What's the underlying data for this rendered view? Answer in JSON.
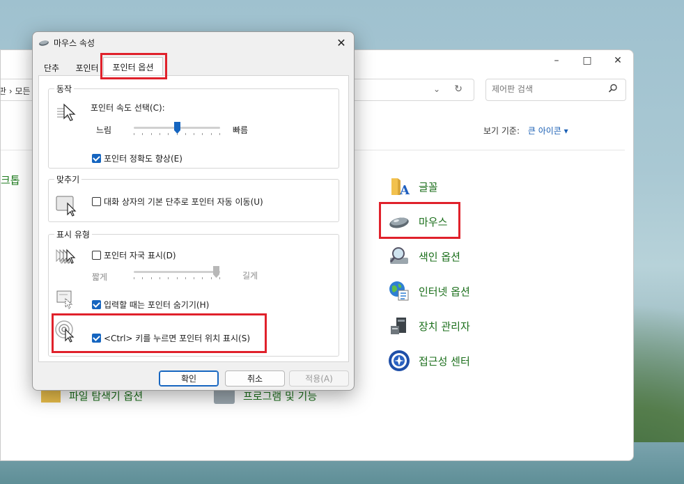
{
  "control_panel": {
    "breadcrumb": "판 › 모든",
    "search_placeholder": "제어판 검색",
    "view_by_label": "보기 기준:",
    "view_by_value": "큰 아이콘 ▾",
    "partial_left_item": "크톱",
    "items": [
      {
        "label": "글꼴",
        "icon": "font-icon"
      },
      {
        "label": "마우스",
        "icon": "mouse-icon"
      },
      {
        "label": "색인 옵션",
        "icon": "indexing-icon"
      },
      {
        "label": "인터넷 옵션",
        "icon": "internet-options-icon"
      },
      {
        "label": "장치 관리자",
        "icon": "device-manager-icon"
      },
      {
        "label": "접근성 센터",
        "icon": "ease-of-access-icon"
      }
    ],
    "bottom_items": [
      "파일 탐색기 옵션",
      "프로그램 및 기능"
    ]
  },
  "dialog": {
    "title": "마우스 속성",
    "tabs": [
      "단추",
      "포인터",
      "포인터 옵션"
    ],
    "active_tab": "포인터 옵션",
    "motion": {
      "group_title": "동작",
      "speed_label": "포인터 속도 선택(C):",
      "slow": "느림",
      "fast": "빠름",
      "speed_value": 0.5,
      "precision_label": "포인터 정확도 향상(E)",
      "precision_checked": true
    },
    "snap": {
      "group_title": "맞추기",
      "snap_label": "대화 상자의 기본 단추로 포인터 자동 이동(U)",
      "snap_checked": false
    },
    "visibility": {
      "group_title": "표시 유형",
      "trails_label": "포인터 자국 표시(D)",
      "trails_checked": false,
      "short": "짧게",
      "long": "길게",
      "trails_value": 1.0,
      "hide_label": "입력할 때는 포인터 숨기기(H)",
      "hide_checked": true,
      "ctrl_label": "<Ctrl> 키를 누르면 포인터 위치 표시(S)",
      "ctrl_checked": true
    },
    "buttons": {
      "ok": "확인",
      "cancel": "취소",
      "apply": "적용(A)"
    }
  },
  "colors": {
    "accent": "#1565c0",
    "highlight": "#e0212b",
    "link_green": "#1a6e1a"
  }
}
